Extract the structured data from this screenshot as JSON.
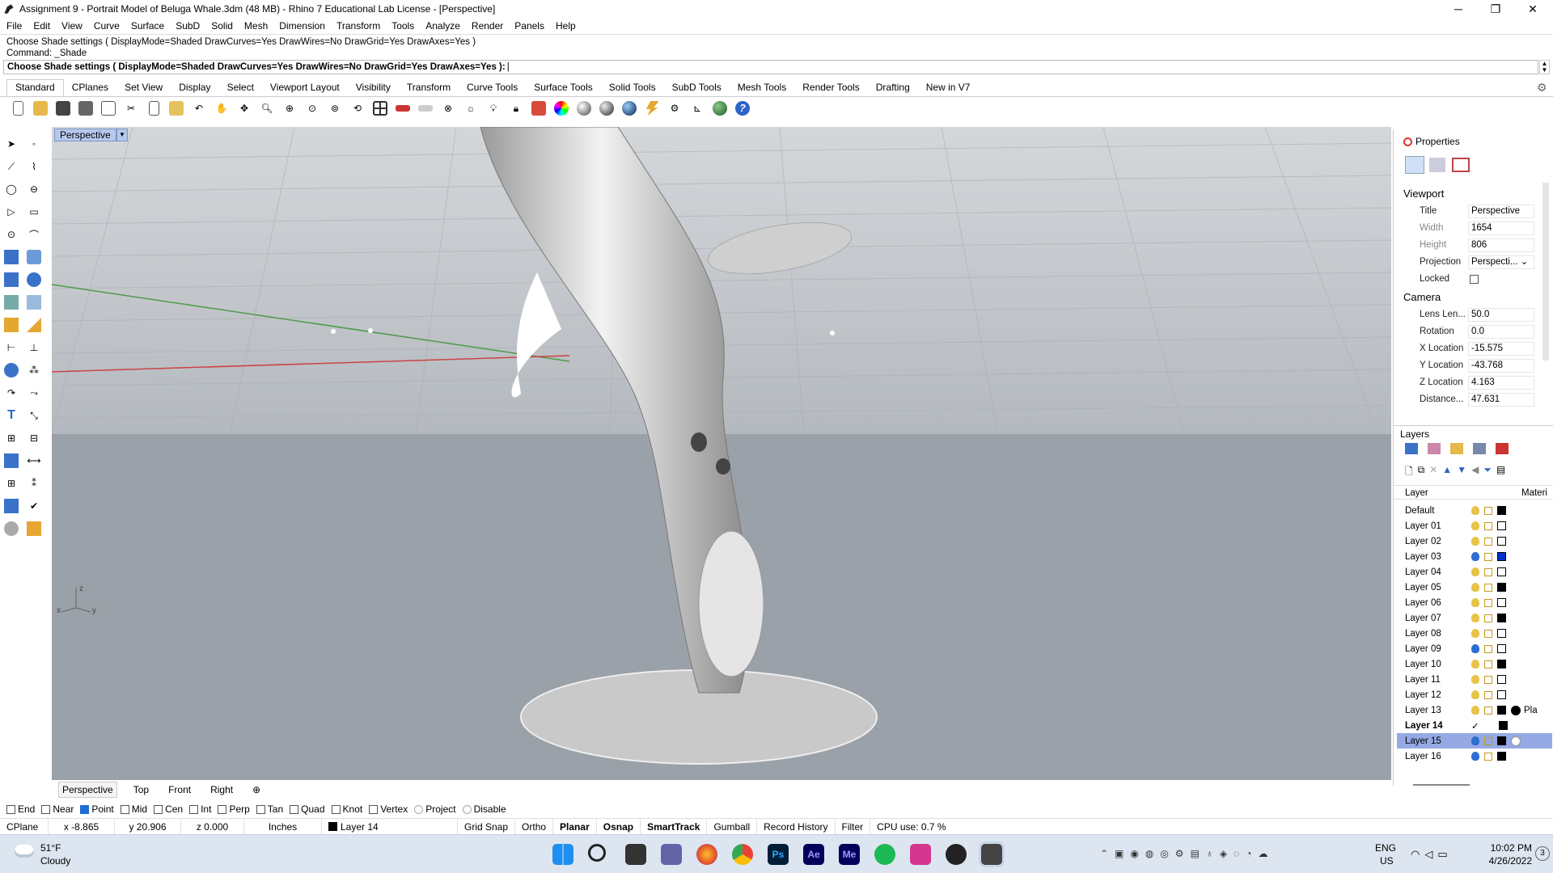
{
  "window": {
    "title": "Assignment 9 - Portrait Model of Beluga Whale.3dm (48 MB) - Rhino 7 Educational Lab License - [Perspective]",
    "minimize": "─",
    "maximize": "❐",
    "close": "✕"
  },
  "menu": [
    "File",
    "Edit",
    "View",
    "Curve",
    "Surface",
    "SubD",
    "Solid",
    "Mesh",
    "Dimension",
    "Transform",
    "Tools",
    "Analyze",
    "Render",
    "Panels",
    "Help"
  ],
  "command": {
    "history1": "Choose Shade settings ( DisplayMode=Shaded  DrawCurves=Yes  DrawWires=No  DrawGrid=Yes  DrawAxes=Yes )",
    "history2": "Command: _Shade",
    "prompt": "Choose Shade settings ( DisplayMode=Shaded  DrawCurves=Yes  DrawWires=No  DrawGrid=Yes  DrawAxes=Yes ):"
  },
  "toolbar_tabs": [
    "Standard",
    "CPlanes",
    "Set View",
    "Display",
    "Select",
    "Viewport Layout",
    "Visibility",
    "Transform",
    "Curve Tools",
    "Surface Tools",
    "Solid Tools",
    "SubD Tools",
    "Mesh Tools",
    "Render Tools",
    "Drafting",
    "New in V7"
  ],
  "viewport": {
    "label": "Perspective",
    "axis_z": "z",
    "axis_x": "x",
    "axis_y": "y"
  },
  "viewport_tabs": [
    "Perspective",
    "Top",
    "Front",
    "Right",
    "⊕"
  ],
  "osnaps": [
    {
      "label": "End",
      "on": false
    },
    {
      "label": "Near",
      "on": false
    },
    {
      "label": "Point",
      "on": true
    },
    {
      "label": "Mid",
      "on": false
    },
    {
      "label": "Cen",
      "on": false
    },
    {
      "label": "Int",
      "on": false
    },
    {
      "label": "Perp",
      "on": false
    },
    {
      "label": "Tan",
      "on": false
    },
    {
      "label": "Quad",
      "on": false
    },
    {
      "label": "Knot",
      "on": false
    },
    {
      "label": "Vertex",
      "on": false
    },
    {
      "label": "Project",
      "on": false
    },
    {
      "label": "Disable",
      "on": false
    }
  ],
  "status": {
    "cplane": "CPlane",
    "x": "x -8.865",
    "y": "y 20.906",
    "z": "z 0.000",
    "units": "Inches",
    "layer": "Layer 14",
    "grid_snap": "Grid Snap",
    "ortho": "Ortho",
    "planar": "Planar",
    "osnap": "Osnap",
    "smarttrack": "SmartTrack",
    "gumball": "Gumball",
    "record_history": "Record History",
    "filter": "Filter",
    "cpu": "CPU use: 0.7 %"
  },
  "properties": {
    "header": "Properties",
    "viewport_section": "Viewport",
    "camera_section": "Camera",
    "rows": [
      {
        "k": "Title",
        "v": "Perspective"
      },
      {
        "k": "Width",
        "v": "1654"
      },
      {
        "k": "Height",
        "v": "806"
      },
      {
        "k": "Projection",
        "v": "Perspecti... ⌄"
      },
      {
        "k": "Locked",
        "v": ""
      }
    ],
    "camera_rows": [
      {
        "k": "Lens Len...",
        "v": "50.0"
      },
      {
        "k": "Rotation",
        "v": "0.0"
      },
      {
        "k": "X Location",
        "v": "-15.575"
      },
      {
        "k": "Y Location",
        "v": "-43.768"
      },
      {
        "k": "Z Location",
        "v": "4.163"
      },
      {
        "k": "Distance...",
        "v": "47.631"
      }
    ]
  },
  "layers": {
    "header": "Layers",
    "col_layer": "Layer",
    "col_material": "Materi",
    "items": [
      {
        "name": "Default",
        "bulb": "yellow",
        "swatch": "#000000"
      },
      {
        "name": "Layer 01",
        "bulb": "yellow",
        "swatch": "#ffffff"
      },
      {
        "name": "Layer 02",
        "bulb": "yellow",
        "swatch": "#ffffff"
      },
      {
        "name": "Layer 03",
        "bulb": "blue",
        "swatch": "#0033cc"
      },
      {
        "name": "Layer 04",
        "bulb": "yellow",
        "swatch": "#ffffff"
      },
      {
        "name": "Layer 05",
        "bulb": "yellow",
        "swatch": "#000000"
      },
      {
        "name": "Layer 06",
        "bulb": "yellow",
        "swatch": "#ffffff"
      },
      {
        "name": "Layer 07",
        "bulb": "yellow",
        "swatch": "#000000"
      },
      {
        "name": "Layer 08",
        "bulb": "yellow",
        "swatch": "#ffffff"
      },
      {
        "name": "Layer 09",
        "bulb": "blue",
        "swatch": "#ffffff"
      },
      {
        "name": "Layer 10",
        "bulb": "yellow",
        "swatch": "#000000"
      },
      {
        "name": "Layer 11",
        "bulb": "yellow",
        "swatch": "#ffffff"
      },
      {
        "name": "Layer 12",
        "bulb": "yellow",
        "swatch": "#ffffff"
      },
      {
        "name": "Layer 13",
        "bulb": "yellow",
        "swatch": "#000000",
        "material": "Pla"
      },
      {
        "name": "Layer 14",
        "bulb": "none",
        "swatch": "#000000",
        "current": "✓"
      },
      {
        "name": "Layer 15",
        "bulb": "blue",
        "swatch": "#000000",
        "selected": true
      },
      {
        "name": "Layer 16",
        "bulb": "blue",
        "swatch": "#000000"
      }
    ]
  },
  "taskbar": {
    "temp": "51°F",
    "weather": "Cloudy",
    "lang1": "ENG",
    "lang2": "US",
    "time": "10:02 PM",
    "date": "4/26/2022",
    "notif": "3"
  },
  "colors": {
    "viewport_bg": "#9aa1a8",
    "selection": "#95a9e4",
    "accent": "#1e6ed6"
  }
}
